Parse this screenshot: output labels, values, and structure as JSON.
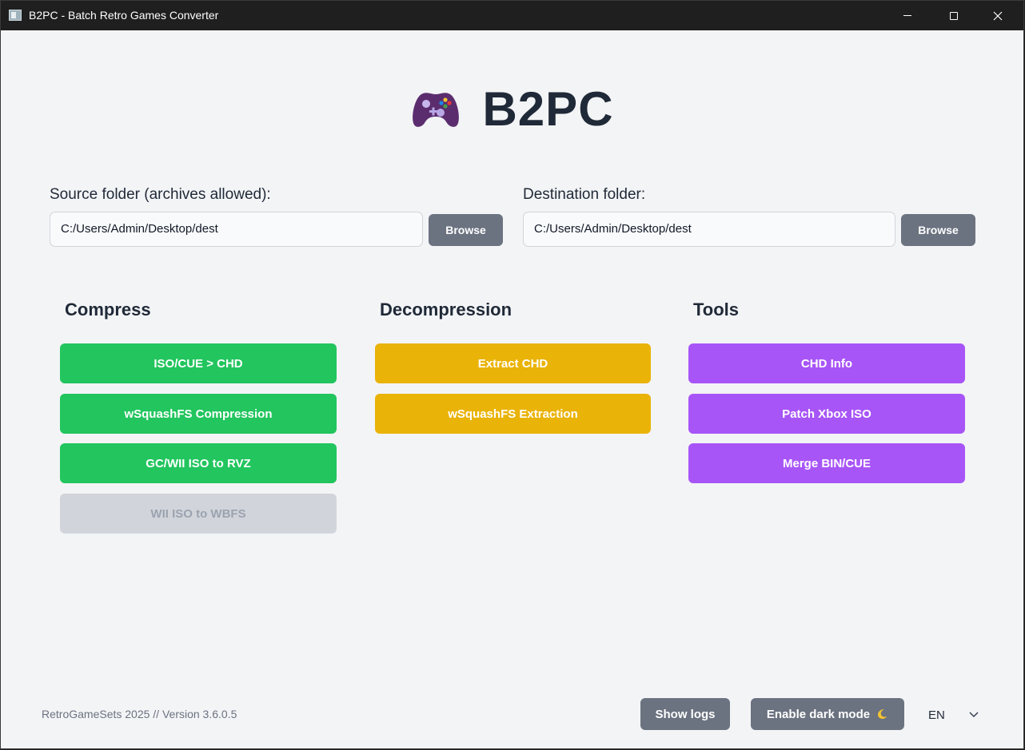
{
  "window": {
    "title": "B2PC - Batch Retro Games Converter"
  },
  "header": {
    "icon": "gamepad-icon",
    "title": "B2PC"
  },
  "source": {
    "label": "Source folder (archives allowed):",
    "value": "C:/Users/Admin/Desktop/dest",
    "browse_label": "Browse"
  },
  "destination": {
    "label": "Destination folder:",
    "value": "C:/Users/Admin/Desktop/dest",
    "browse_label": "Browse"
  },
  "sections": {
    "compress": {
      "title": "Compress",
      "color": "#22c55e",
      "buttons": [
        "ISO/CUE > CHD",
        "wSquashFS Compression",
        "GC/WII ISO to RVZ",
        "WII ISO to WBFS"
      ],
      "disabled": [
        "WII ISO to WBFS"
      ]
    },
    "decompression": {
      "title": "Decompression",
      "color": "#eab308",
      "buttons": [
        "Extract CHD",
        "wSquashFS Extraction"
      ]
    },
    "tools": {
      "title": "Tools",
      "color": "#a855f7",
      "buttons": [
        "CHD Info",
        "Patch Xbox ISO",
        "Merge BIN/CUE"
      ]
    }
  },
  "footer": {
    "version_text": "RetroGameSets 2025 // Version 3.6.0.5",
    "show_logs_label": "Show logs",
    "dark_mode_label": "Enable dark mode",
    "dark_mode_icon": "moon-icon",
    "language": "EN"
  }
}
